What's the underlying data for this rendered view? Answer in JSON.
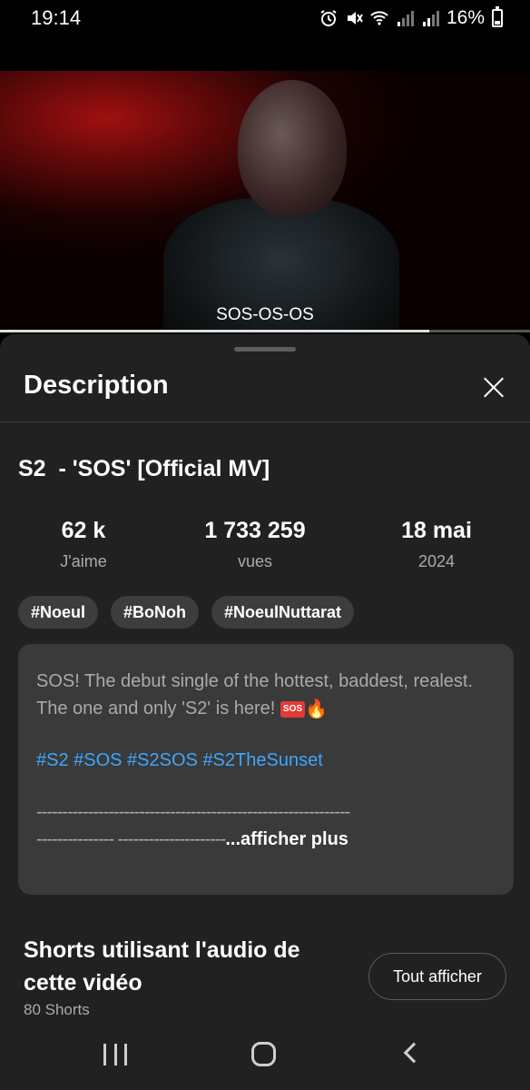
{
  "status_bar": {
    "time": "19:14",
    "battery": "16%",
    "icons": [
      "alarm-icon",
      "mute-icon",
      "wifi-icon",
      "signal-icon",
      "signal-icon",
      "battery-icon"
    ]
  },
  "video": {
    "subtitle": "SOS-OS-OS",
    "progress": 0.81
  },
  "sheet": {
    "title": "Description",
    "video_title": "S2  - 'SOS' [Official MV]",
    "stats": [
      {
        "value": "62 k",
        "label": "J'aime"
      },
      {
        "value": "1 733 259",
        "label": "vues"
      },
      {
        "value": "18 mai",
        "label": "2024"
      }
    ],
    "tags": [
      "#Noeul",
      "#BoNoh",
      "#NoeulNuttarat"
    ],
    "description": {
      "text": "SOS! The debut single of the hottest, baddest, realest. The one and only 'S2' is here!",
      "emoji_1": "SOS",
      "emoji_2": "🔥",
      "hashtags": "#S2 #SOS #S2SOS #S2TheSunset",
      "dashes_1": "-------------------------------------------------------------",
      "dashes_2": "---------------    ---------------------",
      "more": "...afficher plus"
    },
    "shorts": {
      "title": "Shorts utilisant l'audio de cette vidéo",
      "count": "80 Shorts",
      "button": "Tout afficher"
    }
  },
  "colors": {
    "sheet_bg": "#212121",
    "box_bg": "#3a3a3a",
    "link": "#3ea6ff",
    "muted": "#aaaaaa"
  }
}
